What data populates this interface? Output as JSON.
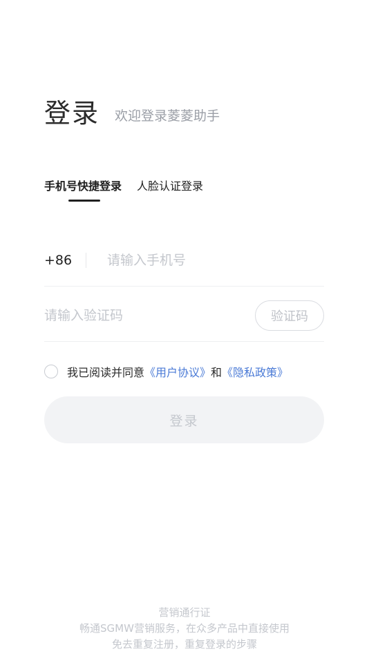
{
  "header": {
    "title": "登录",
    "subtitle": "欢迎登录菱菱助手"
  },
  "tabs": [
    {
      "label": "手机号快捷登录",
      "active": true
    },
    {
      "label": "人脸认证登录",
      "active": false
    }
  ],
  "phone": {
    "country_code": "+86",
    "placeholder": "请输入手机号",
    "value": ""
  },
  "code": {
    "placeholder": "请输入验证码",
    "value": "",
    "button_label": "验证码"
  },
  "agreement": {
    "checked": false,
    "prefix": "我已阅读并同意",
    "user_agreement": "《用户协议》",
    "conjunction": "和",
    "privacy_policy": "《隐私政策》"
  },
  "login_button": "登录",
  "footer": {
    "line1": "营销通行证",
    "line2": "畅通SGMW营销服务，在众多产品中直接使用",
    "line3": "免去重复注册，重复登录的步骤"
  },
  "colors": {
    "link": "#4a7ad6",
    "disabled_button_bg": "#f2f3f5",
    "placeholder": "#c4c7cd"
  }
}
